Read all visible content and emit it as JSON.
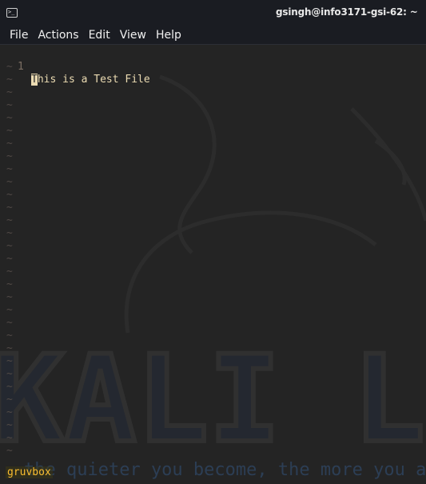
{
  "window": {
    "title": "gsingh@info3171-gsi-62: ~",
    "icon": "terminal-icon"
  },
  "menu": {
    "items": [
      {
        "label": "File"
      },
      {
        "label": "Actions"
      },
      {
        "label": "Edit"
      },
      {
        "label": "View"
      },
      {
        "label": "Help"
      }
    ]
  },
  "editor": {
    "line_number": "1",
    "first_char": "T",
    "rest_of_line": "his is a Test File",
    "empty_line_marker": "~",
    "status": "gruvbox"
  },
  "wallpaper": {
    "brand": "KALI LINUX",
    "tagline": "the quieter you become, the more you are able to hear"
  },
  "colors": {
    "background": "#242424",
    "text": "#ebdbb2",
    "line_number": "#7c6f64",
    "tilde": "#504945",
    "status": "#fabd2f",
    "titlebar": "#1a1c22"
  }
}
